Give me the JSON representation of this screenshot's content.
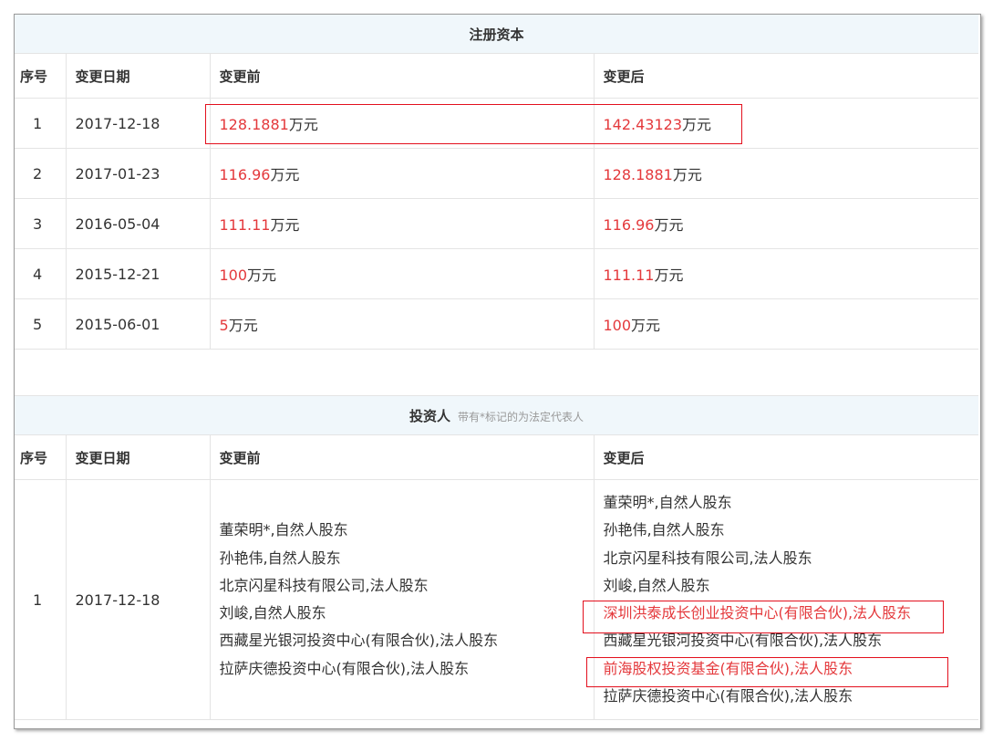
{
  "capital": {
    "title": "注册资本",
    "headers": [
      "序号",
      "变更日期",
      "变更前",
      "变更后"
    ],
    "rows": [
      {
        "no": "1",
        "date": "2017-12-18",
        "before_num": "128.1881",
        "before_unit": "万元",
        "after_num": "142.43123",
        "after_unit": "万元"
      },
      {
        "no": "2",
        "date": "2017-01-23",
        "before_num": "116.96",
        "before_unit": "万元",
        "after_num": "128.1881",
        "after_unit": "万元"
      },
      {
        "no": "3",
        "date": "2016-05-04",
        "before_num": "111.11",
        "before_unit": "万元",
        "after_num": "116.96",
        "after_unit": "万元"
      },
      {
        "no": "4",
        "date": "2015-12-21",
        "before_num": "100",
        "before_unit": "万元",
        "after_num": "111.11",
        "after_unit": "万元"
      },
      {
        "no": "5",
        "date": "2015-06-01",
        "before_num": "5",
        "before_unit": "万元",
        "after_num": "100",
        "after_unit": "万元"
      }
    ]
  },
  "investors": {
    "title": "投资人",
    "note": "带有*标记的为法定代表人",
    "headers": [
      "序号",
      "变更日期",
      "变更前",
      "变更后"
    ],
    "row": {
      "no": "1",
      "date": "2017-12-18",
      "before": [
        "董荣明*,自然人股东",
        "孙艳伟,自然人股东",
        "北京闪星科技有限公司,法人股东",
        "刘峻,自然人股东",
        "西藏星光银河投资中心(有限合伙),法人股东",
        "拉萨庆德投资中心(有限合伙),法人股东"
      ],
      "after": [
        "董荣明*,自然人股东",
        "孙艳伟,自然人股东",
        "北京闪星科技有限公司,法人股东",
        "刘峻,自然人股东",
        "深圳洪泰成长创业投资中心(有限合伙),法人股东",
        "西藏星光银河投资中心(有限合伙),法人股东",
        "前海股权投资基金(有限合伙),法人股东",
        "拉萨庆德投资中心(有限合伙),法人股东"
      ]
    }
  },
  "colors": {
    "accent_red": "#e4393c",
    "highlight_box": "#e30f1d",
    "section_bg": "#f0f7fb"
  }
}
